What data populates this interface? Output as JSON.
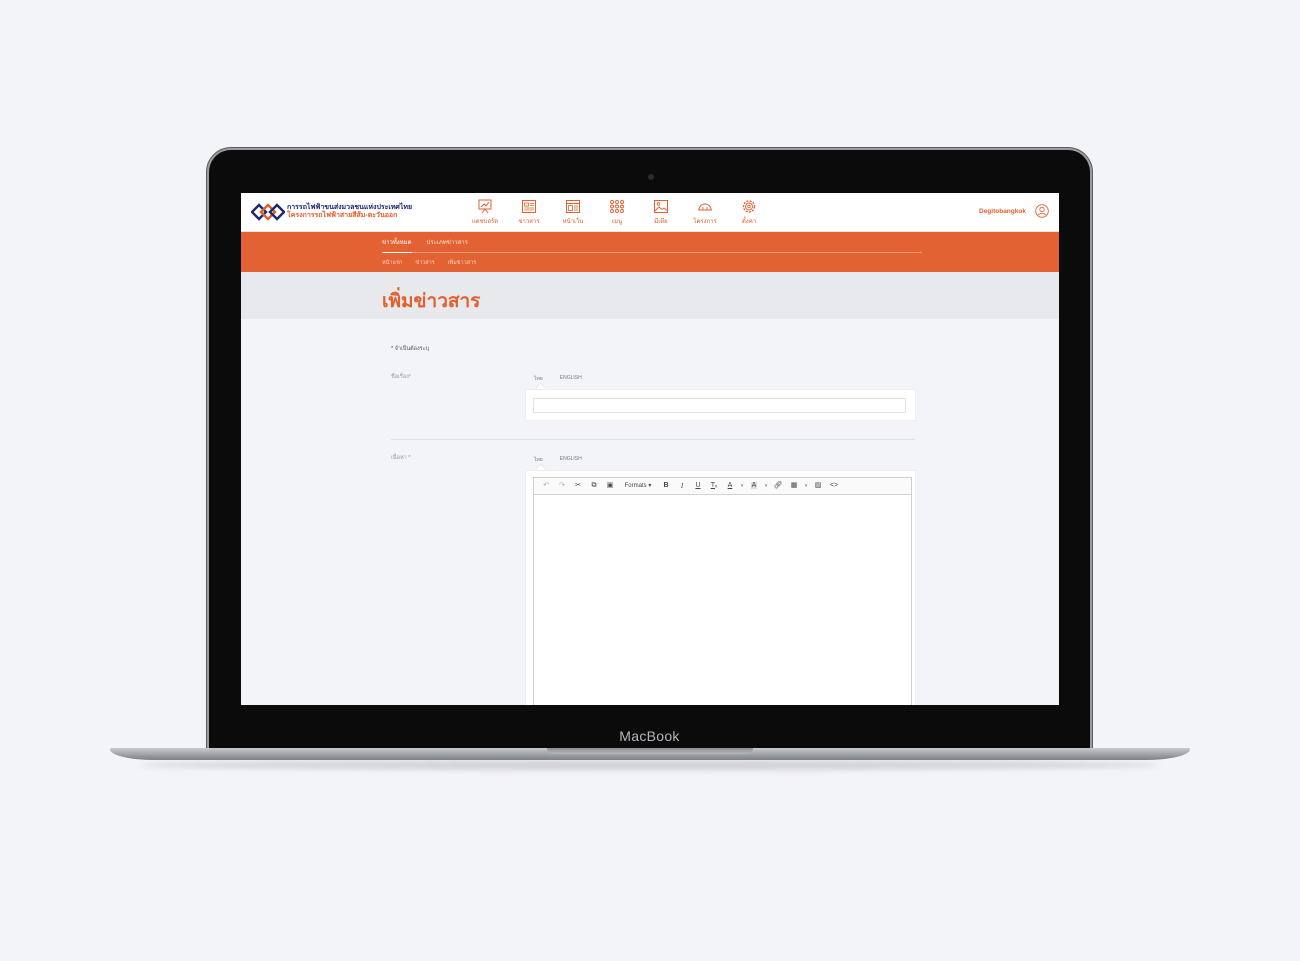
{
  "device": {
    "brand": "MacBook"
  },
  "app": {
    "org_line1": "การรถไฟฟ้าขนส่งมวลชนแห่งประเทศไทย",
    "org_line2": "โครงการรถไฟฟ้าสายสีส้ม-ตะวันออก",
    "user_name": "Degitobangkok"
  },
  "nav": {
    "items": [
      {
        "label": "แดชบอร์ด",
        "icon": "dashboard-icon"
      },
      {
        "label": "ข่าวสาร",
        "icon": "news-icon"
      },
      {
        "label": "หน้าเว็บ",
        "icon": "webpage-icon"
      },
      {
        "label": "เมนู",
        "icon": "menu-grid-icon"
      },
      {
        "label": "มีเดีย",
        "icon": "media-icon"
      },
      {
        "label": "โครงการ",
        "icon": "project-icon"
      },
      {
        "label": "ตั้งค่า",
        "icon": "settings-icon"
      }
    ]
  },
  "subnav": {
    "tabs": [
      {
        "label": "ข่าวทั้งหมด"
      },
      {
        "label": "ประเภทข่าวสาร"
      }
    ],
    "breadcrumb": [
      "หน้าแรก",
      "ข่าวสาร",
      "เพิ่มข่าวสาร"
    ]
  },
  "page": {
    "title": "เพิ่มข่าวสาร",
    "required_note": "* จำเป็นต้องระบุ"
  },
  "form": {
    "title_label": "ชื่อเรื่อง*",
    "content_label": "เนื้อหา *",
    "lang_tabs": [
      "ไทย",
      "ENGLISH"
    ],
    "title_value": "",
    "editor": {
      "formats_label": "Formats"
    }
  },
  "colors": {
    "accent": "#e26233",
    "navy": "#1f2a6b"
  }
}
